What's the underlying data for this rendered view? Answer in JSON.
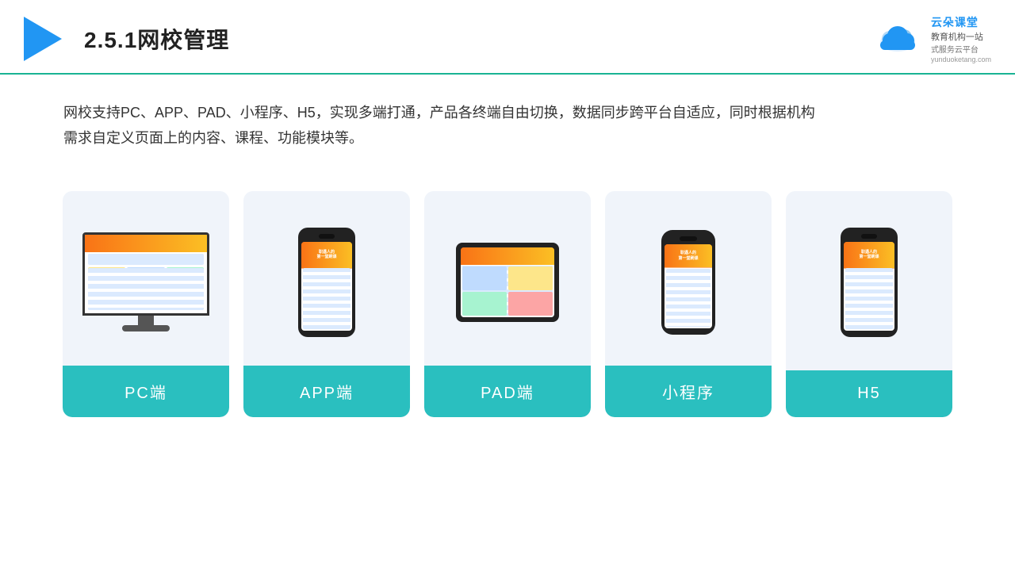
{
  "header": {
    "title": "2.5.1网校管理",
    "brand": {
      "name": "云朵课堂",
      "url": "yunduoketang.com",
      "sub1": "教育机构一站",
      "sub2": "式服务云平台"
    }
  },
  "description": {
    "text1": "网校支持PC、APP、PAD、小程序、H5，实现多端打通，产品各终端自由切换，数据同步跨平台自适应，同时根据机构",
    "text2": "需求自定义页面上的内容、课程、功能模块等。"
  },
  "cards": [
    {
      "id": "pc",
      "label": "PC端",
      "type": "pc"
    },
    {
      "id": "app",
      "label": "APP端",
      "type": "phone"
    },
    {
      "id": "pad",
      "label": "PAD端",
      "type": "tablet"
    },
    {
      "id": "miniapp",
      "label": "小程序",
      "type": "mini-phone"
    },
    {
      "id": "h5",
      "label": "H5",
      "type": "phone2"
    }
  ],
  "colors": {
    "accent": "#2abfbf",
    "header_border": "#1ab394",
    "card_bg": "#f0f4fa",
    "title_color": "#222",
    "text_color": "#333"
  }
}
